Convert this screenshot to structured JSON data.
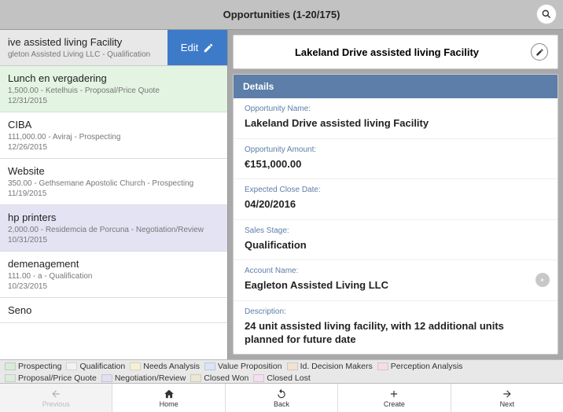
{
  "header": {
    "title": "Opportunities (1-20/175)"
  },
  "selected": {
    "title": "ive assisted living Facility",
    "sub": "gleton Assisted Living LLC - Qualification",
    "edit_label": "Edit"
  },
  "list": [
    {
      "title": "Lunch en vergadering",
      "sub": "1,500.00 - Ketelhuis - Proposal/Price Quote",
      "date": "12/31/2015",
      "cls": "c-green"
    },
    {
      "title": "CIBA",
      "sub": "111,000.00 - Aviraj - Prospecting",
      "date": "12/26/2015",
      "cls": "c-white"
    },
    {
      "title": "Website",
      "sub": "350.00 - Gethsemane Apostolic Church - Prospecting",
      "date": "11/19/2015",
      "cls": "c-white"
    },
    {
      "title": "hp printers",
      "sub": "2,000.00 - Residemcia de Porcuna - Negotiation/Review",
      "date": "10/31/2015",
      "cls": "c-lav"
    },
    {
      "title": "demenagement",
      "sub": "111.00 - a - Qualification",
      "date": "10/23/2015",
      "cls": "c-white"
    },
    {
      "title": "Seno",
      "sub": "",
      "date": "",
      "cls": "c-white"
    }
  ],
  "detail": {
    "title": "Lakeland Drive assisted living Facility",
    "section_label": "Details",
    "fields": {
      "opp_name_label": "Opportunity Name:",
      "opp_name_value": "Lakeland Drive assisted living Facility",
      "amount_label": "Opportunity Amount:",
      "amount_value": "€151,000.00",
      "close_label": "Expected Close Date:",
      "close_value": "04/20/2016",
      "stage_label": "Sales Stage:",
      "stage_value": "Qualification",
      "account_label": "Account Name:",
      "account_value": "Eagleton Assisted Living LLC",
      "desc_label": "Description:",
      "desc_value": "24 unit assisted living facility, with 12 additional units planned for future date"
    }
  },
  "legend": [
    {
      "label": "Prospecting",
      "color": "#d9eadb"
    },
    {
      "label": "Qualification",
      "color": "#f2f2f2"
    },
    {
      "label": "Needs Analysis",
      "color": "#f5f0d6"
    },
    {
      "label": "Value Proposition",
      "color": "#d9e5f2"
    },
    {
      "label": "Id. Decision Makers",
      "color": "#f2e2d4"
    },
    {
      "label": "Perception Analysis",
      "color": "#f3dde6"
    },
    {
      "label": "Proposal/Price Quote",
      "color": "#dcebdc"
    },
    {
      "label": "Negotiation/Review",
      "color": "#e2e0f0"
    },
    {
      "label": "Closed Won",
      "color": "#ece6d2"
    },
    {
      "label": "Closed Lost",
      "color": "#f4def0"
    }
  ],
  "bottom": {
    "previous": "Previous",
    "home": "Home",
    "back": "Back",
    "create": "Create",
    "next": "Next"
  }
}
